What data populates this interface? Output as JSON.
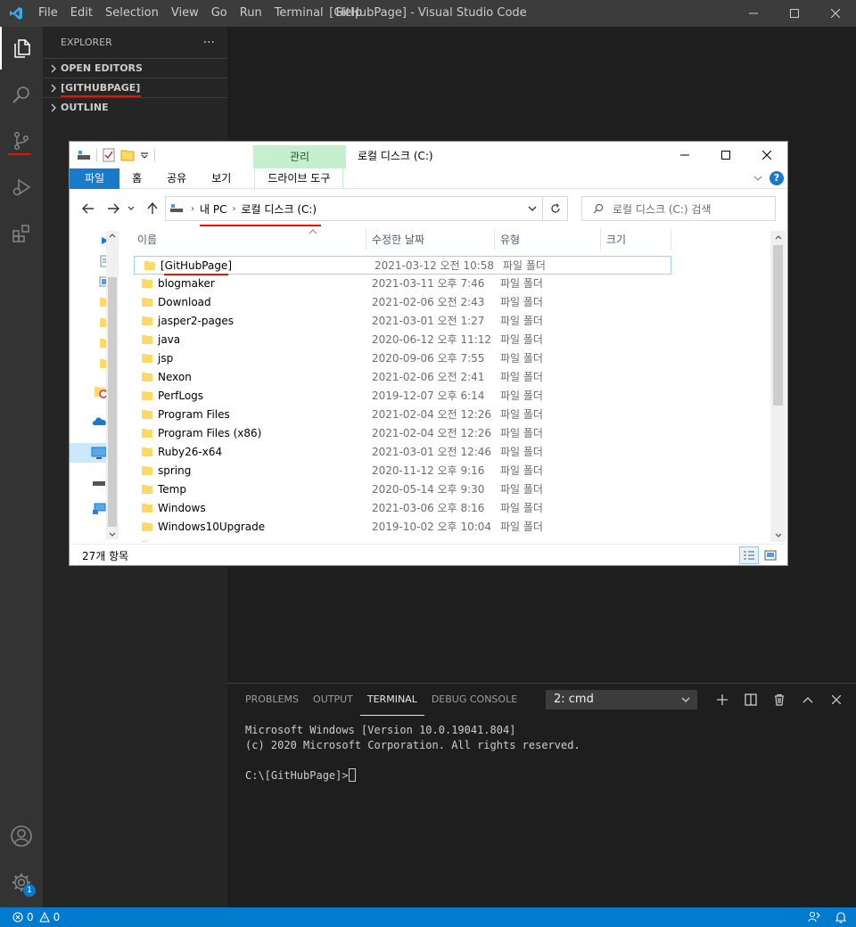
{
  "window": {
    "title": "[GitHubPage] - Visual Studio Code",
    "menu": [
      "File",
      "Edit",
      "Selection",
      "View",
      "Go",
      "Run",
      "Terminal",
      "Help"
    ]
  },
  "activity_bar": {
    "items": [
      {
        "name": "explorer-icon",
        "active": true
      },
      {
        "name": "search-icon"
      },
      {
        "name": "source-control-icon"
      },
      {
        "name": "run-debug-icon"
      },
      {
        "name": "extensions-icon"
      }
    ],
    "settings_badge": "1"
  },
  "sidebar": {
    "title": "EXPLORER",
    "more": "···",
    "sections": [
      "OPEN EDITORS",
      "[GITHUBPAGE]",
      "OUTLINE"
    ]
  },
  "file_explorer": {
    "manage_tab": "관리",
    "window_title": "로컬 디스크 (C:)",
    "ribbon_tabs": [
      "파일",
      "홈",
      "공유",
      "보기",
      "드라이브 도구"
    ],
    "help": "?",
    "breadcrumb": [
      "내 PC",
      "로컬 디스크 (C:)"
    ],
    "search_placeholder": "로컬 디스크 (C:) 검색",
    "columns": [
      "이름",
      "수정한 날짜",
      "유형",
      "크기"
    ],
    "rows": [
      {
        "name": "[GitHubPage]",
        "date": "2021-03-12 오전 10:58",
        "type": "파일 폴더"
      },
      {
        "name": "blogmaker",
        "date": "2021-03-11 오후 7:46",
        "type": "파일 폴더"
      },
      {
        "name": "Download",
        "date": "2021-02-06 오전 2:43",
        "type": "파일 폴더"
      },
      {
        "name": "jasper2-pages",
        "date": "2021-03-01 오전 1:27",
        "type": "파일 폴더"
      },
      {
        "name": "java",
        "date": "2020-06-12 오후 11:12",
        "type": "파일 폴더"
      },
      {
        "name": "jsp",
        "date": "2020-09-06 오후 7:55",
        "type": "파일 폴더"
      },
      {
        "name": "Nexon",
        "date": "2021-02-06 오전 2:41",
        "type": "파일 폴더"
      },
      {
        "name": "PerfLogs",
        "date": "2019-12-07 오후 6:14",
        "type": "파일 폴더"
      },
      {
        "name": "Program Files",
        "date": "2021-02-04 오전 12:26",
        "type": "파일 폴더"
      },
      {
        "name": "Program Files (x86)",
        "date": "2021-02-04 오전 12:26",
        "type": "파일 폴더"
      },
      {
        "name": "Ruby26-x64",
        "date": "2021-03-01 오전 12:46",
        "type": "파일 폴더"
      },
      {
        "name": "spring",
        "date": "2020-11-12 오후 9:16",
        "type": "파일 폴더"
      },
      {
        "name": "Temp",
        "date": "2020-05-14 오후 9:30",
        "type": "파일 폴더"
      },
      {
        "name": "Windows",
        "date": "2021-03-06 오후 8:16",
        "type": "파일 폴더"
      },
      {
        "name": "Windows10Upgrade",
        "date": "2019-10-02 오후 10:04",
        "type": "파일 폴더"
      }
    ],
    "status": "27개 항목"
  },
  "panel": {
    "tabs": [
      "PROBLEMS",
      "OUTPUT",
      "TERMINAL",
      "DEBUG CONSOLE"
    ],
    "active_tab": "TERMINAL",
    "terminal_select": "2: cmd",
    "terminal_lines": [
      "Microsoft Windows [Version 10.0.19041.804]",
      "(c) 2020 Microsoft Corporation. All rights reserved.",
      "",
      "C:\\[GitHubPage]>"
    ]
  },
  "statusbar": {
    "errors": "0",
    "warnings": "0"
  },
  "colors": {
    "accent": "#007acc",
    "annotation": "#e51400",
    "manage_tab": "#c6efce",
    "file_tab": "#1979ca"
  }
}
